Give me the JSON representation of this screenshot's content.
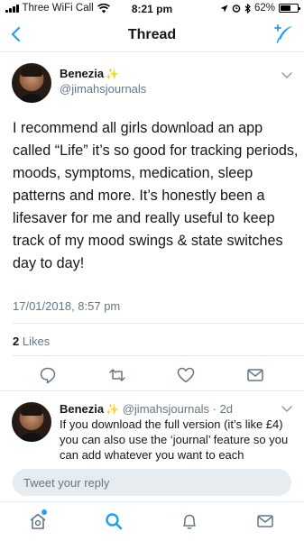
{
  "status_bar": {
    "carrier": "Three WiFi Call",
    "time": "8:21 pm",
    "battery_text": "62%",
    "battery_level": 0.62
  },
  "nav": {
    "title": "Thread"
  },
  "tweet": {
    "display_name": "Benezia",
    "name_emoji": "✨",
    "handle": "@jimahsjournals",
    "text": "I recommend all girls download an app called “Life” it’s so good for tracking periods, moods, symptoms, medication, sleep patterns and more. It’s honestly been a lifesaver for me and really useful to keep track of my mood swings & state switches day to day!",
    "timestamp": "17/01/2018, 8:57 pm",
    "likes_count": "2",
    "likes_label": "Likes"
  },
  "reply": {
    "display_name": "Benezia",
    "name_emoji": "✨",
    "handle": "@jimahsjournals",
    "age": "· 2d",
    "text": "If you download the full version (it’s like £4) you can also use the ‘journal’ feature so you can add whatever you want to each"
  },
  "reply_box": {
    "placeholder": "Tweet your reply"
  },
  "icons": {
    "back": "chevron-left-icon",
    "compose": "compose-icon",
    "reply": "reply-icon",
    "retweet": "retweet-icon",
    "like": "heart-icon",
    "share": "envelope-icon",
    "tabs": [
      "home-icon",
      "search-icon",
      "bell-icon",
      "envelope-icon"
    ]
  },
  "colors": {
    "accent": "#1da1f2",
    "text": "#14171a",
    "secondary": "#657786",
    "sparkle": "#f2c84b"
  }
}
